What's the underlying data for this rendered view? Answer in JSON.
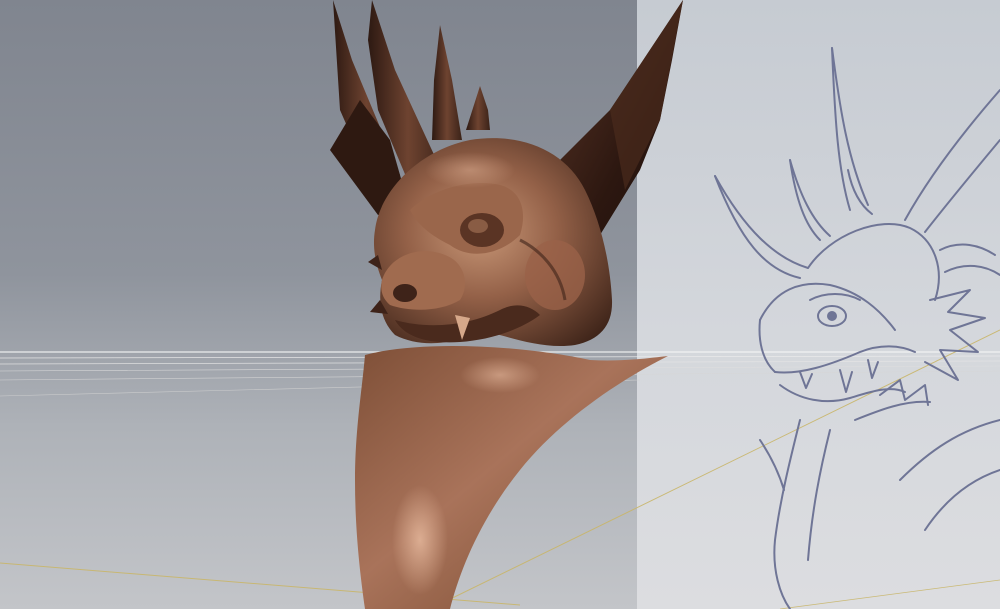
{
  "scene": {
    "background_left_color": "#8b9099",
    "background_right_color": "#d2d5da",
    "model_color": "#8a5a3e",
    "sketch_color": "#6f7596",
    "grid_line_color": "#c9b66a"
  }
}
